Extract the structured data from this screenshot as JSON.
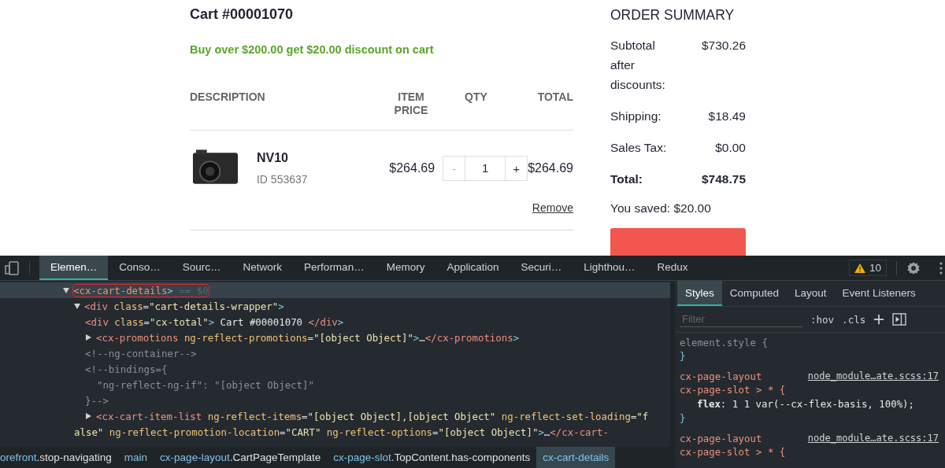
{
  "page": {
    "cart_title": "Cart #00001070",
    "promotion": "Buy over $200.00 get $20.00 discount on cart",
    "columns": [
      {
        "label": "DESCRIPTION",
        "kind": "left"
      },
      {
        "label": "ITEM PRICE",
        "kind": "center"
      },
      {
        "label": "QTY",
        "kind": "center"
      },
      {
        "label": "TOTAL",
        "kind": "right"
      }
    ],
    "items": [
      {
        "name": "NV10",
        "id": "ID 553637",
        "price": "$264.69",
        "qty": "1",
        "minus": "-",
        "plus": "+",
        "minus_disabled": true,
        "total": "$264.69",
        "remove": "Remove"
      }
    ],
    "summary": {
      "title": "ORDER SUMMARY",
      "rows": [
        {
          "label": "Subtotal after discounts:",
          "value": "$730.26",
          "kind": "normal"
        },
        {
          "label": "Shipping:",
          "value": "$18.49",
          "kind": "normal"
        },
        {
          "label": "Sales Tax:",
          "value": "$0.00",
          "kind": "normal"
        },
        {
          "label": "Total:",
          "value": "$748.75",
          "kind": "total"
        }
      ],
      "saved": "You saved: $20.00"
    }
  },
  "devtools": {
    "tabs": [
      {
        "label": "Elemen…",
        "selected": true
      },
      {
        "label": "Conso…",
        "selected": false
      },
      {
        "label": "Sourc…",
        "selected": false
      },
      {
        "label": "Network",
        "selected": false
      },
      {
        "label": "Performan…",
        "selected": false
      },
      {
        "label": "Memory",
        "selected": false
      },
      {
        "label": "Application",
        "selected": false
      },
      {
        "label": "Securi…",
        "selected": false
      },
      {
        "label": "Lighthou…",
        "selected": false
      },
      {
        "label": "Redux",
        "selected": false
      }
    ],
    "warnings": "10",
    "nodes": [
      {
        "selected": true,
        "annotated": true,
        "expanded": true,
        "lines": [
          [
            {
              "kind": "tag",
              "t": "<cx-cart-details"
            },
            {
              "kind": "punct",
              "t": ">"
            },
            {
              "kind": "hint",
              "t": " == $0"
            }
          ]
        ],
        "children": [
          {
            "selected": false,
            "annotated": false,
            "expanded": true,
            "lines": [
              [
                {
                  "kind": "tag",
                  "t": "<div"
                },
                {
                  "kind": "attr",
                  "t": " class"
                },
                {
                  "kind": "text",
                  "t": "="
                },
                {
                  "kind": "value",
                  "t": "\"cart-details-wrapper\""
                },
                {
                  "kind": "punct",
                  "t": ">"
                }
              ]
            ],
            "children": [
              {
                "selected": false,
                "annotated": false,
                "lines": [
                  [
                    {
                      "kind": "tag",
                      "t": "<div"
                    },
                    {
                      "kind": "attr",
                      "t": " class"
                    },
                    {
                      "kind": "text",
                      "t": "="
                    },
                    {
                      "kind": "value",
                      "t": "\"cx-total\""
                    },
                    {
                      "kind": "punct",
                      "t": ">"
                    },
                    {
                      "kind": "text",
                      "t": " Cart #00001070 "
                    },
                    {
                      "kind": "tag",
                      "t": "</div"
                    },
                    {
                      "kind": "punct",
                      "t": ">"
                    }
                  ]
                ]
              },
              {
                "selected": false,
                "annotated": false,
                "expanded": false,
                "lines": [
                  [
                    {
                      "kind": "tag",
                      "t": "<cx-promotions"
                    },
                    {
                      "kind": "attr",
                      "t": " ng-reflect-promotions"
                    },
                    {
                      "kind": "text",
                      "t": "="
                    },
                    {
                      "kind": "value",
                      "t": "\"[object Object]\""
                    },
                    {
                      "kind": "punct",
                      "t": ">"
                    },
                    {
                      "kind": "text",
                      "t": "…"
                    },
                    {
                      "kind": "tag",
                      "t": "</cx-promotions"
                    },
                    {
                      "kind": "punct",
                      "t": ">"
                    }
                  ]
                ]
              },
              {
                "selected": false,
                "annotated": false,
                "lines": [
                  [
                    {
                      "kind": "comment",
                      "t": "<!--ng-container-->"
                    }
                  ]
                ]
              },
              {
                "selected": false,
                "annotated": false,
                "lines": [
                  [
                    {
                      "kind": "comment",
                      "t": "<!--bindings={"
                    }
                  ],
                  [
                    {
                      "kind": "comment",
                      "t": "  \"ng-reflect-ng-if\": \"[object Object]\""
                    }
                  ],
                  [
                    {
                      "kind": "comment",
                      "t": "}-->"
                    }
                  ]
                ]
              },
              {
                "selected": false,
                "annotated": false,
                "expanded": false,
                "lines": [
                  [
                    {
                      "kind": "tag",
                      "t": "<cx-cart-item-list"
                    },
                    {
                      "kind": "attr",
                      "t": " ng-reflect-items"
                    },
                    {
                      "kind": "text",
                      "t": "="
                    },
                    {
                      "kind": "value",
                      "t": "\"[object Object],[object Object\""
                    },
                    {
                      "kind": "attr",
                      "t": " ng-reflect-set-loading"
                    },
                    {
                      "kind": "text",
                      "t": "="
                    },
                    {
                      "kind": "value",
                      "t": "\"f"
                    }
                  ],
                  [
                    {
                      "kind": "value",
                      "t": "alse\""
                    },
                    {
                      "kind": "attr",
                      "t": " ng-reflect-promotion-location"
                    },
                    {
                      "kind": "text",
                      "t": "="
                    },
                    {
                      "kind": "value",
                      "t": "\"CART\""
                    },
                    {
                      "kind": "attr",
                      "t": " ng-reflect-options"
                    },
                    {
                      "kind": "text",
                      "t": "="
                    },
                    {
                      "kind": "value",
                      "t": "\"[object Object]\""
                    },
                    {
                      "kind": "punct",
                      "t": ">"
                    },
                    {
                      "kind": "text",
                      "t": "…"
                    },
                    {
                      "kind": "tag",
                      "t": "</cx-cart-"
                    }
                  ]
                ]
              }
            ]
          }
        ]
      }
    ],
    "breadcrumbs": [
      {
        "name": "orefront",
        "classes": ".stop-navigating",
        "selected": false
      },
      {
        "name": "main",
        "selected": false
      },
      {
        "name": "cx-page-layout",
        "classes": ".CartPageTemplate",
        "selected": false
      },
      {
        "name": "cx-page-slot",
        "classes": ".TopContent.has-components",
        "selected": false
      },
      {
        "name": "cx-cart-details",
        "selected": true
      }
    ],
    "side_tabs": [
      {
        "label": "Styles",
        "selected": true
      },
      {
        "label": "Computed",
        "selected": false
      },
      {
        "label": "Layout",
        "selected": false
      },
      {
        "label": "Event Listeners",
        "selected": false
      }
    ],
    "filter": {
      "placeholder": "Filter"
    },
    "hov": ":hov",
    "cls": ".cls",
    "rules": [
      {
        "selector_lines": [
          "element.style {"
        ],
        "close": "}"
      },
      {
        "selector_lines": [
          "cx-page-layout",
          "cx-page-slot > * {"
        ],
        "source": "node_module…ate.scss:17",
        "declarations": [
          "**flex**: 1 1 var(--cx-flex-basis, 100%);"
        ],
        "close": "}"
      },
      {
        "selector_lines": [
          "cx-page-layout",
          "cx-page-slot > * {"
        ],
        "source": "node_module…ate.scss:17"
      }
    ]
  }
}
